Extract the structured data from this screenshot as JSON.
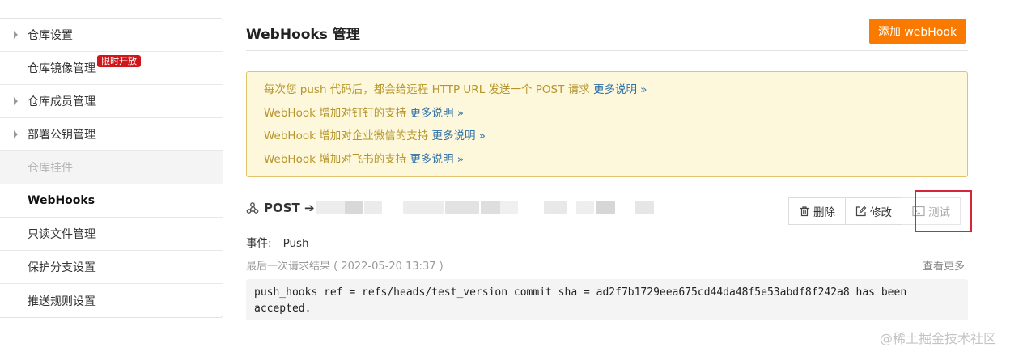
{
  "sidebar": {
    "items": [
      {
        "label": "仓库设置"
      },
      {
        "label": "仓库镜像管理",
        "badge": "限时开放"
      },
      {
        "label": "仓库成员管理"
      },
      {
        "label": "部署公钥管理"
      },
      {
        "label": "仓库挂件"
      },
      {
        "label": "WebHooks"
      },
      {
        "label": "只读文件管理"
      },
      {
        "label": "保护分支设置"
      },
      {
        "label": "推送规则设置"
      }
    ]
  },
  "header": {
    "title": "WebHooks 管理",
    "add_button": "添加 webHook"
  },
  "notice": {
    "lines": [
      {
        "text": "每次您 push 代码后，都会给远程 HTTP URL 发送一个 POST 请求 ",
        "link": "更多说明 »"
      },
      {
        "text": "WebHook 增加对钉钉的支持 ",
        "link": "更多说明 »"
      },
      {
        "text": "WebHook 增加对企业微信的支持 ",
        "link": "更多说明 »"
      },
      {
        "text": "WebHook 增加对飞书的支持 ",
        "link": "更多说明 »"
      }
    ]
  },
  "hook": {
    "method": "POST ➔",
    "icon": "webhook-icon",
    "actions": {
      "delete": "删除",
      "edit": "修改",
      "test": "测试"
    },
    "event_label": "事件:",
    "event_value": "Push",
    "last_result": "最后一次请求结果 ( 2022-05-20 13:37 )",
    "more": "查看更多",
    "response": "push_hooks ref = refs/heads/test_version commit sha = ad2f7b1729eea675cd44da48f5e53abdf8f242a8 has been accepted."
  },
  "watermark": "@稀土掘金技术社区",
  "colors": {
    "accent": "#fa7a00",
    "badge": "#d0161b",
    "notice_bg": "#fdf8dc",
    "notice_text": "#b7952b",
    "link": "#2d6fa6",
    "highlight_frame": "#d6253a"
  }
}
